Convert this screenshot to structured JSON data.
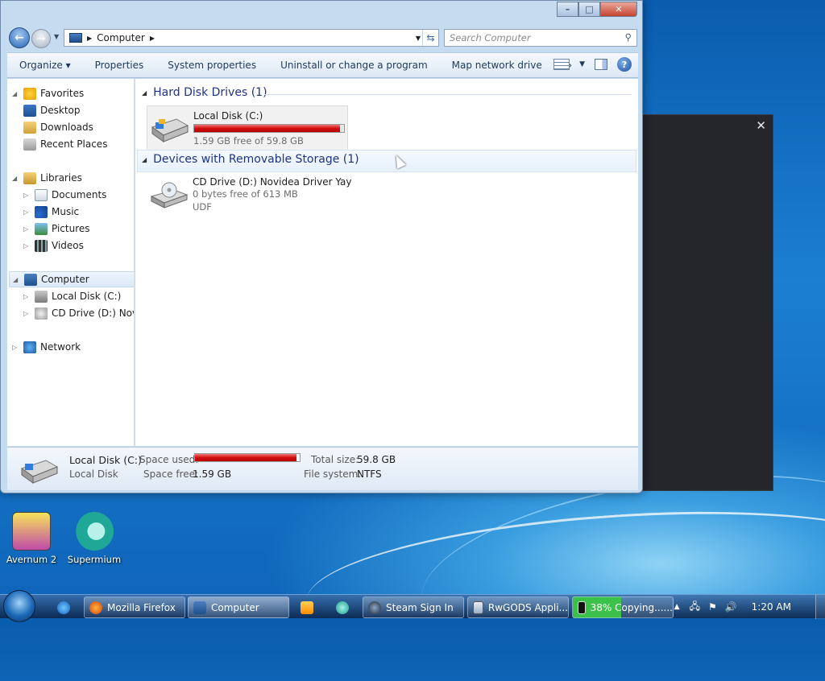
{
  "window": {
    "title": "Computer",
    "close_glyph": "✕",
    "min_glyph": "–",
    "max_glyph": "□"
  },
  "nav": {
    "address_crumb": "Computer",
    "search_placeholder": "Search Computer"
  },
  "toolbar": {
    "organize": "Organize ▾",
    "properties": "Properties",
    "system_properties": "System properties",
    "uninstall": "Uninstall or change a program",
    "map_drive": "Map network drive",
    "more": "»",
    "help": "?"
  },
  "sidebar": {
    "favorites": "Favorites",
    "desktop": "Desktop",
    "downloads": "Downloads",
    "recent_places": "Recent Places",
    "libraries": "Libraries",
    "documents": "Documents",
    "music": "Music",
    "pictures": "Pictures",
    "videos": "Videos",
    "computer": "Computer",
    "local_disk": "Local Disk (C:)",
    "cd_drive": "CD Drive (D:) Novide",
    "network": "Network"
  },
  "groups": {
    "hdd": "Hard Disk Drives (1)",
    "removable": "Devices with Removable Storage (1)"
  },
  "drives": [
    {
      "name": "Local Disk (C:)",
      "free_text": "1.59 GB free of 59.8 GB",
      "used_fraction": 0.973
    },
    {
      "name": "CD Drive (D:) Novidea Driver Yay",
      "free_text": "0 bytes free of 613 MB",
      "fs": "UDF"
    }
  ],
  "details": {
    "name": "Local Disk (C:)",
    "type": "Local Disk",
    "space_used_label": "Space used:",
    "space_free_label": "Space free:",
    "space_free": "1.59 GB",
    "total_size_label": "Total size:",
    "total_size": "59.8 GB",
    "fs_label": "File system:",
    "fs": "NTFS",
    "used_fraction": 0.973
  },
  "desktop_icons": [
    "Avernum 2",
    "Supermium"
  ],
  "dark_window": {
    "close_glyph": "✕"
  },
  "taskbar": {
    "items": [
      "Mozilla Firefox",
      "Computer",
      "Steam Sign In",
      "RwGODS Appli...",
      "38% Copying......"
    ],
    "copy_progress": 0.38,
    "clock": "1:20 AM",
    "tray_up": "▲"
  }
}
